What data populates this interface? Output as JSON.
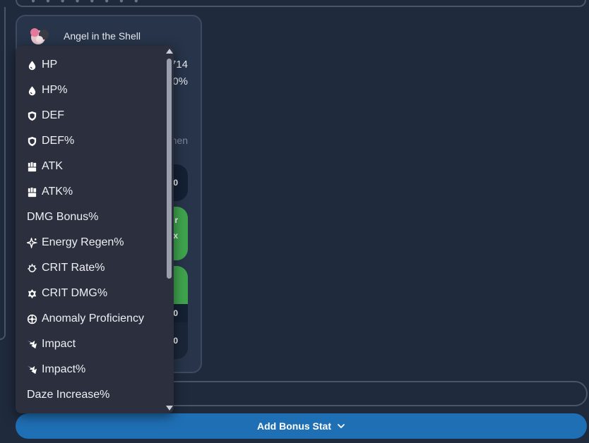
{
  "top_bar": {
    "dots": "● ● ● ● ● ● ● ●"
  },
  "card": {
    "name": "Angel in the Shell",
    "partial_values": [
      "714",
      "0%"
    ],
    "muted_text": "nen",
    "pill_texts": [
      "0",
      "r",
      "x",
      "0",
      "0"
    ]
  },
  "dropdown": {
    "items": [
      {
        "label": "HP",
        "icon": "hp-drop-icon"
      },
      {
        "label": "HP%",
        "icon": "hp-drop-icon"
      },
      {
        "label": "DEF",
        "icon": "shield-icon"
      },
      {
        "label": "DEF%",
        "icon": "shield-icon"
      },
      {
        "label": "ATK",
        "icon": "fist-icon"
      },
      {
        "label": "ATK%",
        "icon": "fist-icon"
      },
      {
        "label": "DMG Bonus%",
        "icon": ""
      },
      {
        "label": "Energy Regen%",
        "icon": "sparkle-icon"
      },
      {
        "label": "CRIT Rate%",
        "icon": "crit-rate-icon"
      },
      {
        "label": "CRIT DMG%",
        "icon": "crit-dmg-icon"
      },
      {
        "label": "Anomaly Proficiency",
        "icon": "anomaly-icon"
      },
      {
        "label": "Impact",
        "icon": "impact-icon"
      },
      {
        "label": "Impact%",
        "icon": "impact-icon"
      },
      {
        "label": "Daze Increase%",
        "icon": ""
      }
    ]
  },
  "add_bonus_button": {
    "label": "Add Bonus Stat",
    "icon": "chevron-down-icon"
  },
  "colors": {
    "background": "#1f2a3d",
    "card": "#273449",
    "dropdown": "#2b2f3e",
    "accent_blue": "#1f6fb5",
    "accent_green": "#3fa34d"
  }
}
